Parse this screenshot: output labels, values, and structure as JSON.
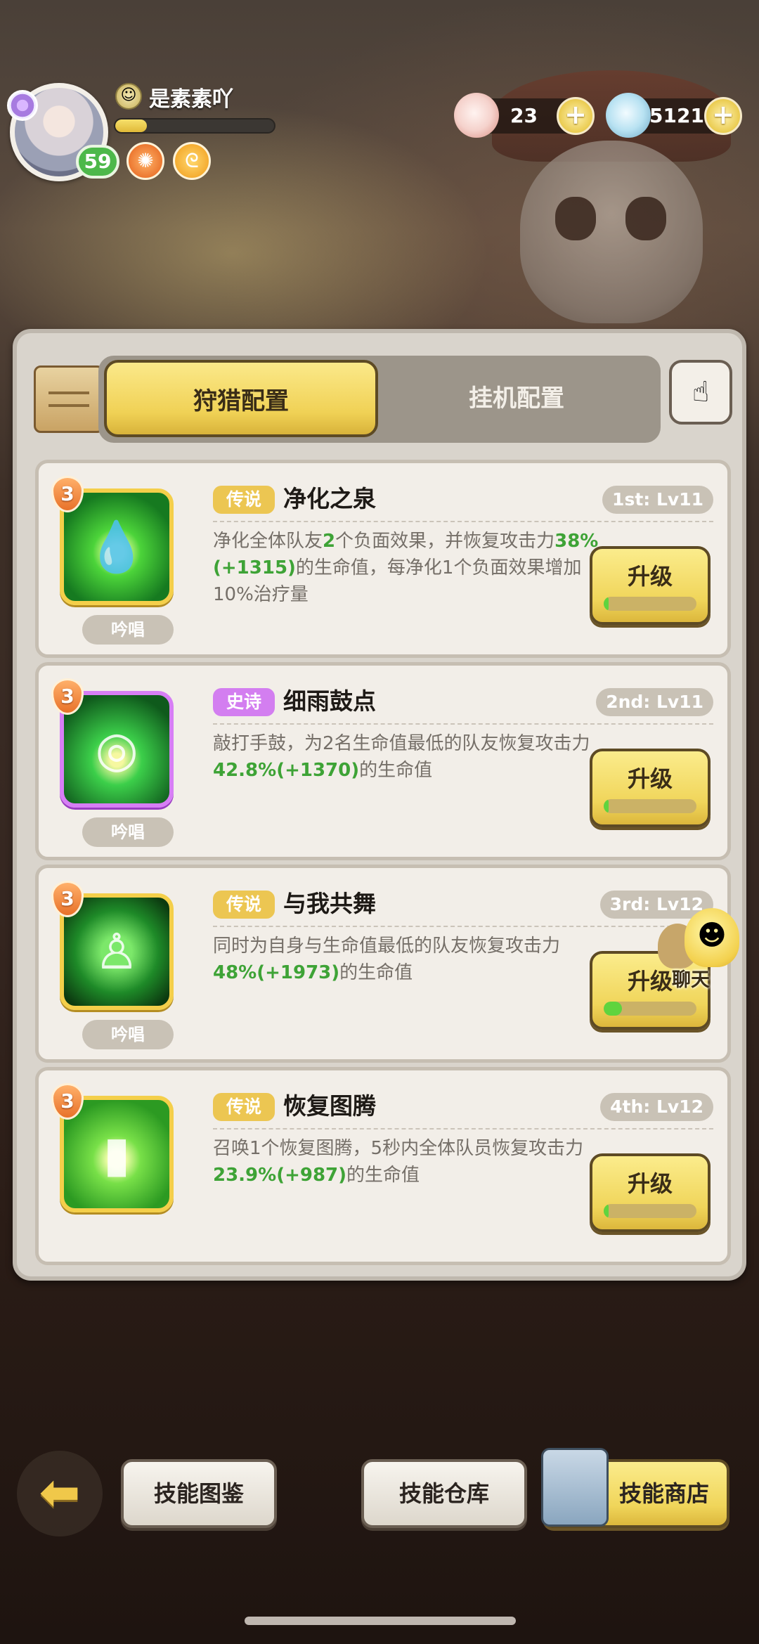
{
  "player": {
    "name": "是素素吖",
    "level": "59",
    "xp_fraction": 0.2
  },
  "currencies": [
    {
      "icon": "shell-icon",
      "value": "23"
    },
    {
      "icon": "pearl-icon",
      "value": "51215"
    }
  ],
  "tabs": {
    "hunt": "狩猎配置",
    "idle": "挂机配置"
  },
  "skills": [
    {
      "tier": "3",
      "rarity": "传说",
      "name": "净化之泉",
      "rank": "1st: Lv11",
      "cast": "吟唱",
      "desc_parts": [
        "净化全体队友",
        "2",
        "个负面效果，并恢复攻击力",
        "38%(+1315)",
        "的生命值，每净化1个负面效果增加10%治疗量"
      ],
      "upgrade_label": "升级",
      "upgrade_progress": 0.02
    },
    {
      "tier": "3",
      "rarity": "史诗",
      "name": "细雨鼓点",
      "rank": "2nd: Lv11",
      "cast": "吟唱",
      "desc_parts": [
        "敲打手鼓，为2名生命值最低的队友恢复攻击力",
        "42.8%(+1370)",
        "的生命值"
      ],
      "upgrade_label": "升级",
      "upgrade_progress": 0.02
    },
    {
      "tier": "3",
      "rarity": "传说",
      "name": "与我共舞",
      "rank": "3rd: Lv12",
      "cast": "吟唱",
      "desc_parts": [
        "同时为自身与生命值最低的队友恢复攻击力",
        "48%(+1973)",
        "的生命值"
      ],
      "upgrade_label": "升级",
      "upgrade_progress": 0.2
    },
    {
      "tier": "3",
      "rarity": "传说",
      "name": "恢复图腾",
      "rank": "4th: Lv12",
      "cast": "",
      "desc_parts": [
        "召唤1个恢复图腾，5秒内全体队员恢复攻击力",
        "23.9%(+987)",
        "的生命值"
      ],
      "upgrade_label": "升级",
      "upgrade_progress": 0.02
    }
  ],
  "chat": {
    "label": "聊天"
  },
  "bottom": {
    "catalog": "技能图鉴",
    "warehouse": "技能仓库",
    "shop": "技能商店"
  },
  "colors": {
    "legend": "#ecc652",
    "epic": "#d37ef0",
    "highlight_green": "#3ea336"
  }
}
